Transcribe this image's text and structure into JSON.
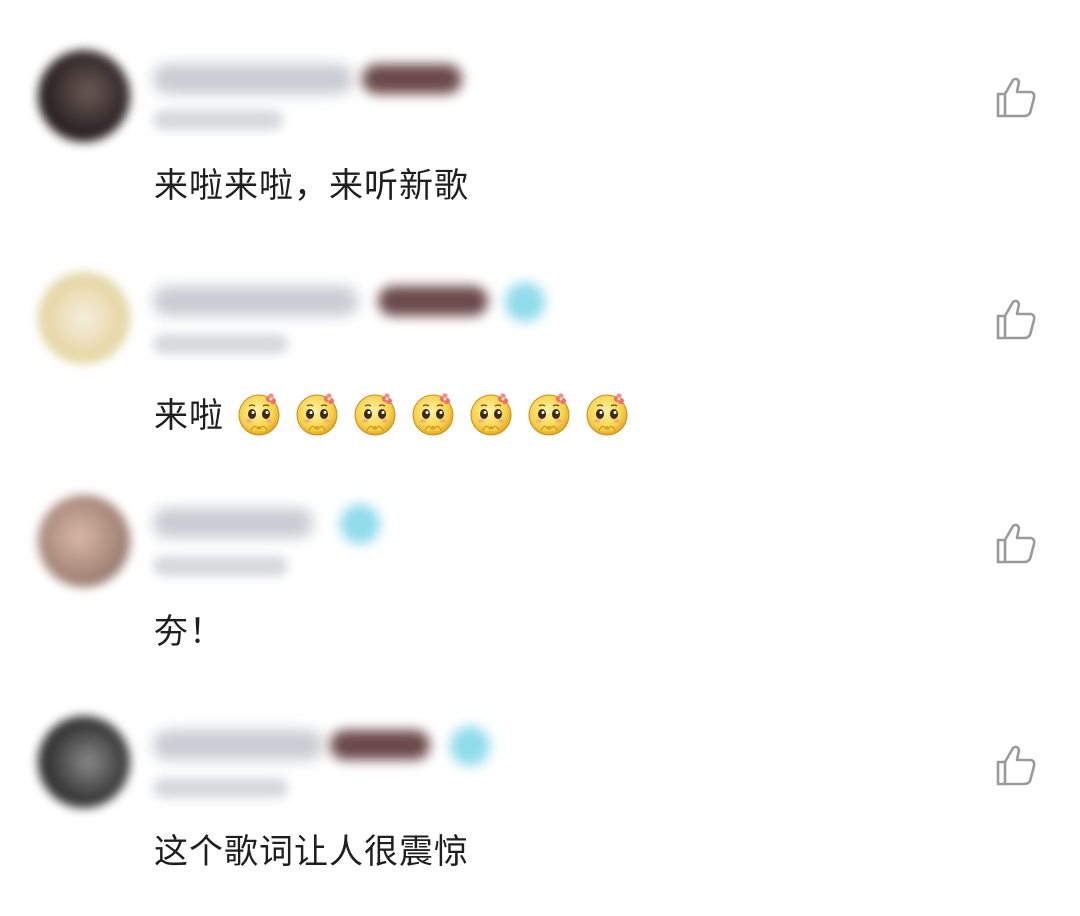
{
  "comments": [
    {
      "text": "来啦来啦，来听新歌",
      "emoji_count": 0
    },
    {
      "text": "来啦",
      "emoji_count": 7,
      "emoji_icon": "shy-pleading-face-icon"
    },
    {
      "text": "夯！",
      "emoji_count": 0
    },
    {
      "text": "这个歌词让人很震惊",
      "emoji_count": 0
    }
  ],
  "icons": {
    "like": "thumbs-up-icon"
  },
  "colors": {
    "text": "#1f1f1f",
    "icon": "#9a9a9a",
    "verified": "#8fdcea"
  }
}
